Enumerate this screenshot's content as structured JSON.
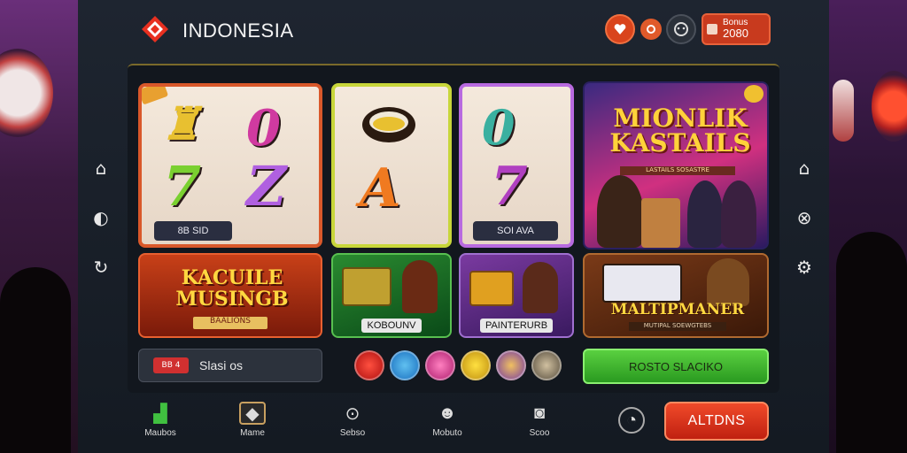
{
  "header": {
    "brand": "INDONESIA",
    "balance_label": "Bonus",
    "balance_value": "2080"
  },
  "tiles": {
    "slot1_label": "8B SID",
    "slot3_label": "SOI AVA",
    "featured_title": "MIONLIK KASTAILS",
    "featured_sub": "LASTAILS SOSASTRE",
    "tile5_title": "KACUILE MUSINGB",
    "tile5_sub": "BAALIONS",
    "tile6_caption": "KOBOUNV",
    "tile7_caption": "PAINTERURB",
    "tile8_title": "MALTIPMANER",
    "tile8_sub": "MUTIPAL SOEWGTEBS"
  },
  "search": {
    "pill": "BB 4",
    "text": "Slasi os"
  },
  "promo_button": "ROSTO SLACIKO",
  "nav": [
    {
      "label": "Maubos"
    },
    {
      "label": "Mame"
    },
    {
      "label": "Sebso"
    },
    {
      "label": "Mobuto"
    },
    {
      "label": "Scoo"
    }
  ],
  "cta_button": "ALTDNS",
  "colors": {
    "accent_red": "#e04020",
    "accent_green": "#4ac030",
    "frame_bg": "#1a2028"
  }
}
